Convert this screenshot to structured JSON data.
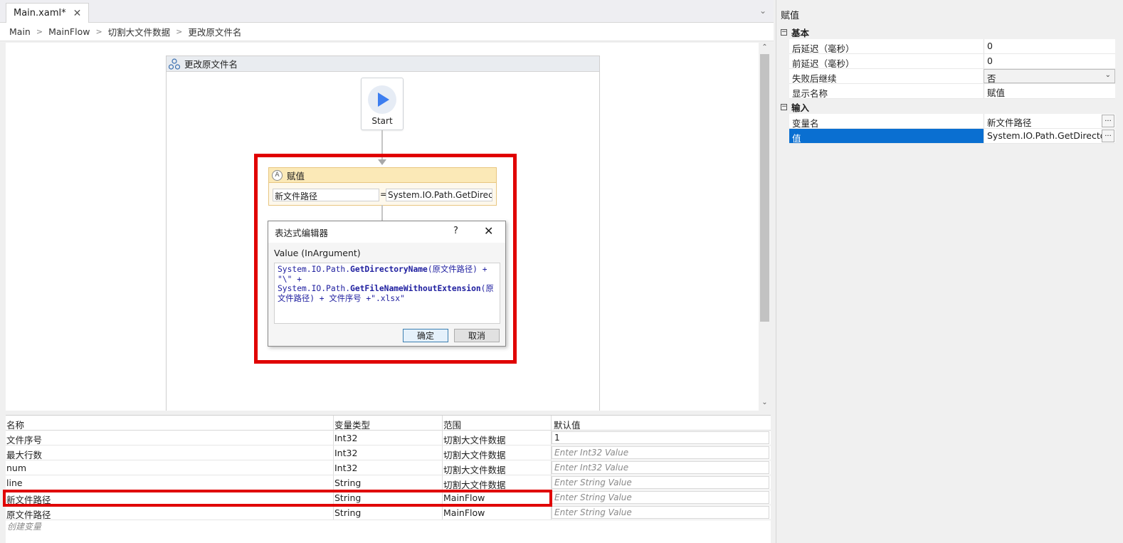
{
  "editor": {
    "tab_title": "Main.xaml*",
    "breadcrumb": [
      "Main",
      "MainFlow",
      "切割大文件数据",
      "更改原文件名"
    ]
  },
  "flowchart": {
    "title": "更改原文件名",
    "start_label": "Start",
    "assign": {
      "title": "赋值",
      "to": "新文件路径",
      "equals": "=",
      "value": "System.IO.Path.GetDirectc"
    }
  },
  "dialog": {
    "title": "表达式编辑器",
    "help": "?",
    "close": "✕",
    "label": "Value (InArgument)",
    "code": "System.IO.Path.GetDirectoryName(原文件路径) +\n\"\\\" +\nSystem.IO.Path.GetFileNameWithoutExtension(原文件路径) + 文件序号 +\".xlsx\"",
    "ok": "确定",
    "cancel": "取消"
  },
  "variables": {
    "headers": [
      "名称",
      "变量类型",
      "范围",
      "默认值"
    ],
    "rows": [
      {
        "name": "文件序号",
        "type": "Int32",
        "scope": "切割大文件数据",
        "default": "1",
        "placeholder": false
      },
      {
        "name": "最大行数",
        "type": "Int32",
        "scope": "切割大文件数据",
        "default": "Enter Int32 Value",
        "placeholder": true
      },
      {
        "name": "num",
        "type": "Int32",
        "scope": "切割大文件数据",
        "default": "Enter Int32 Value",
        "placeholder": true
      },
      {
        "name": "line",
        "type": "String",
        "scope": "切割大文件数据",
        "default": "Enter String Value",
        "placeholder": true
      },
      {
        "name": "新文件路径",
        "type": "String",
        "scope": "MainFlow",
        "default": "Enter String Value",
        "placeholder": true
      },
      {
        "name": "原文件路径",
        "type": "String",
        "scope": "MainFlow",
        "default": "Enter String Value",
        "placeholder": true
      }
    ],
    "create_label": "创建变量"
  },
  "properties": {
    "title": "赋值",
    "cat_basic": "基本",
    "cat_input": "输入",
    "basic": [
      {
        "name": "后延迟（毫秒）",
        "value": "0"
      },
      {
        "name": "前延迟（毫秒）",
        "value": "0"
      },
      {
        "name": "失败后继续",
        "value": "否"
      },
      {
        "name": "显示名称",
        "value": "赋值"
      }
    ],
    "input": [
      {
        "name": "变量名",
        "value": "新文件路径"
      },
      {
        "name": "值",
        "value": "System.IO.Path.GetDirectory"
      }
    ],
    "dots": "...",
    "collapse": "−"
  },
  "colors": {
    "highlight_red": "#e00000",
    "selection_blue": "#0a6fd1",
    "assign_header": "#fbe9b7",
    "play_blue": "#3d7ef0"
  }
}
